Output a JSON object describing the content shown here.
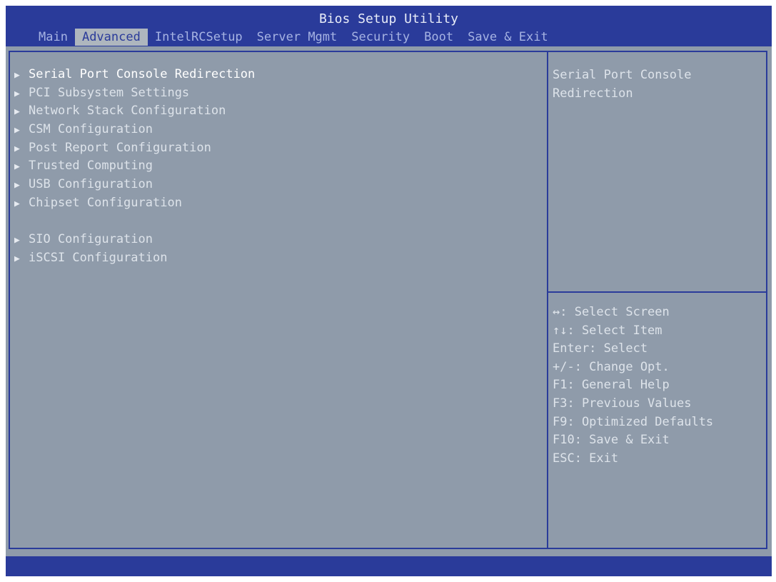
{
  "title": "Bios Setup Utility",
  "tabs": [
    {
      "label": "Main"
    },
    {
      "label": "Advanced"
    },
    {
      "label": "IntelRCSetup"
    },
    {
      "label": "Server Mgmt"
    },
    {
      "label": "Security"
    },
    {
      "label": "Boot"
    },
    {
      "label": "Save & Exit"
    }
  ],
  "active_tab": "Advanced",
  "menu": {
    "items": [
      {
        "label": "Serial Port Console Redirection"
      },
      {
        "label": "PCI Subsystem Settings"
      },
      {
        "label": "Network Stack Configuration"
      },
      {
        "label": "CSM Configuration"
      },
      {
        "label": "Post Report Configuration"
      },
      {
        "label": "Trusted Computing"
      },
      {
        "label": "USB Configuration"
      },
      {
        "label": "Chipset Configuration"
      },
      {
        "label": "SIO Configuration"
      },
      {
        "label": "iSCSI Configuration"
      }
    ],
    "selected": "Serial Port Console Redirection"
  },
  "help": {
    "line1": "Serial Port Console",
    "line2": "Redirection"
  },
  "keys": [
    "↔: Select Screen",
    "↑↓: Select Item",
    "Enter: Select",
    "+/-: Change Opt.",
    "F1: General Help",
    "F3: Previous Values",
    "F9: Optimized Defaults",
    "F10: Save & Exit",
    "ESC: Exit"
  ],
  "colors": {
    "header_bg": "#2a3b9a",
    "panel_bg": "#8f9baa",
    "active_tab_bg": "#aeb6be"
  }
}
